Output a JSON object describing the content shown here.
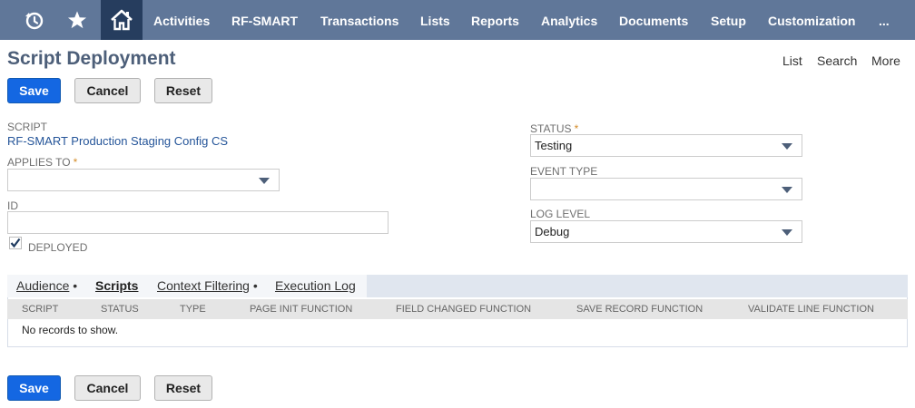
{
  "nav": {
    "icons": [
      "recent-records-icon",
      "star-icon",
      "home-icon"
    ],
    "items": [
      "Activities",
      "RF-SMART",
      "Transactions",
      "Lists",
      "Reports",
      "Analytics",
      "Documents",
      "Setup",
      "Customization",
      "..."
    ]
  },
  "header": {
    "title": "Script Deployment",
    "links": [
      "List",
      "Search",
      "More"
    ]
  },
  "buttons": {
    "save": "Save",
    "cancel": "Cancel",
    "reset": "Reset"
  },
  "form": {
    "script": {
      "label": "SCRIPT",
      "value": "RF-SMART Production Staging Config CS"
    },
    "applies_to": {
      "label": "APPLIES TO",
      "required": "*",
      "value": ""
    },
    "id": {
      "label": "ID",
      "value": ""
    },
    "deployed": {
      "label": "DEPLOYED",
      "checked": true
    },
    "status": {
      "label": "STATUS",
      "required": "*",
      "value": "Testing"
    },
    "event_type": {
      "label": "EVENT TYPE",
      "value": ""
    },
    "log_level": {
      "label": "LOG LEVEL",
      "value": "Debug"
    }
  },
  "tabs": [
    {
      "label": "Audience",
      "dot": "•",
      "active": false
    },
    {
      "label": "Scripts",
      "dot": "",
      "active": true
    },
    {
      "label": "Context Filtering",
      "dot": "•",
      "active": false
    },
    {
      "label": "Execution Log",
      "dot": "",
      "active": false
    }
  ],
  "table": {
    "columns": [
      "SCRIPT",
      "STATUS",
      "TYPE",
      "PAGE INIT FUNCTION",
      "FIELD CHANGED FUNCTION",
      "SAVE RECORD FUNCTION",
      "VALIDATE LINE FUNCTION"
    ],
    "empty_message": "No records to show."
  },
  "colors": {
    "nav_bg": "#607799",
    "nav_active": "#263d5e",
    "primary": "#1467e2",
    "link": "#255599",
    "title": "#4d5f79"
  }
}
